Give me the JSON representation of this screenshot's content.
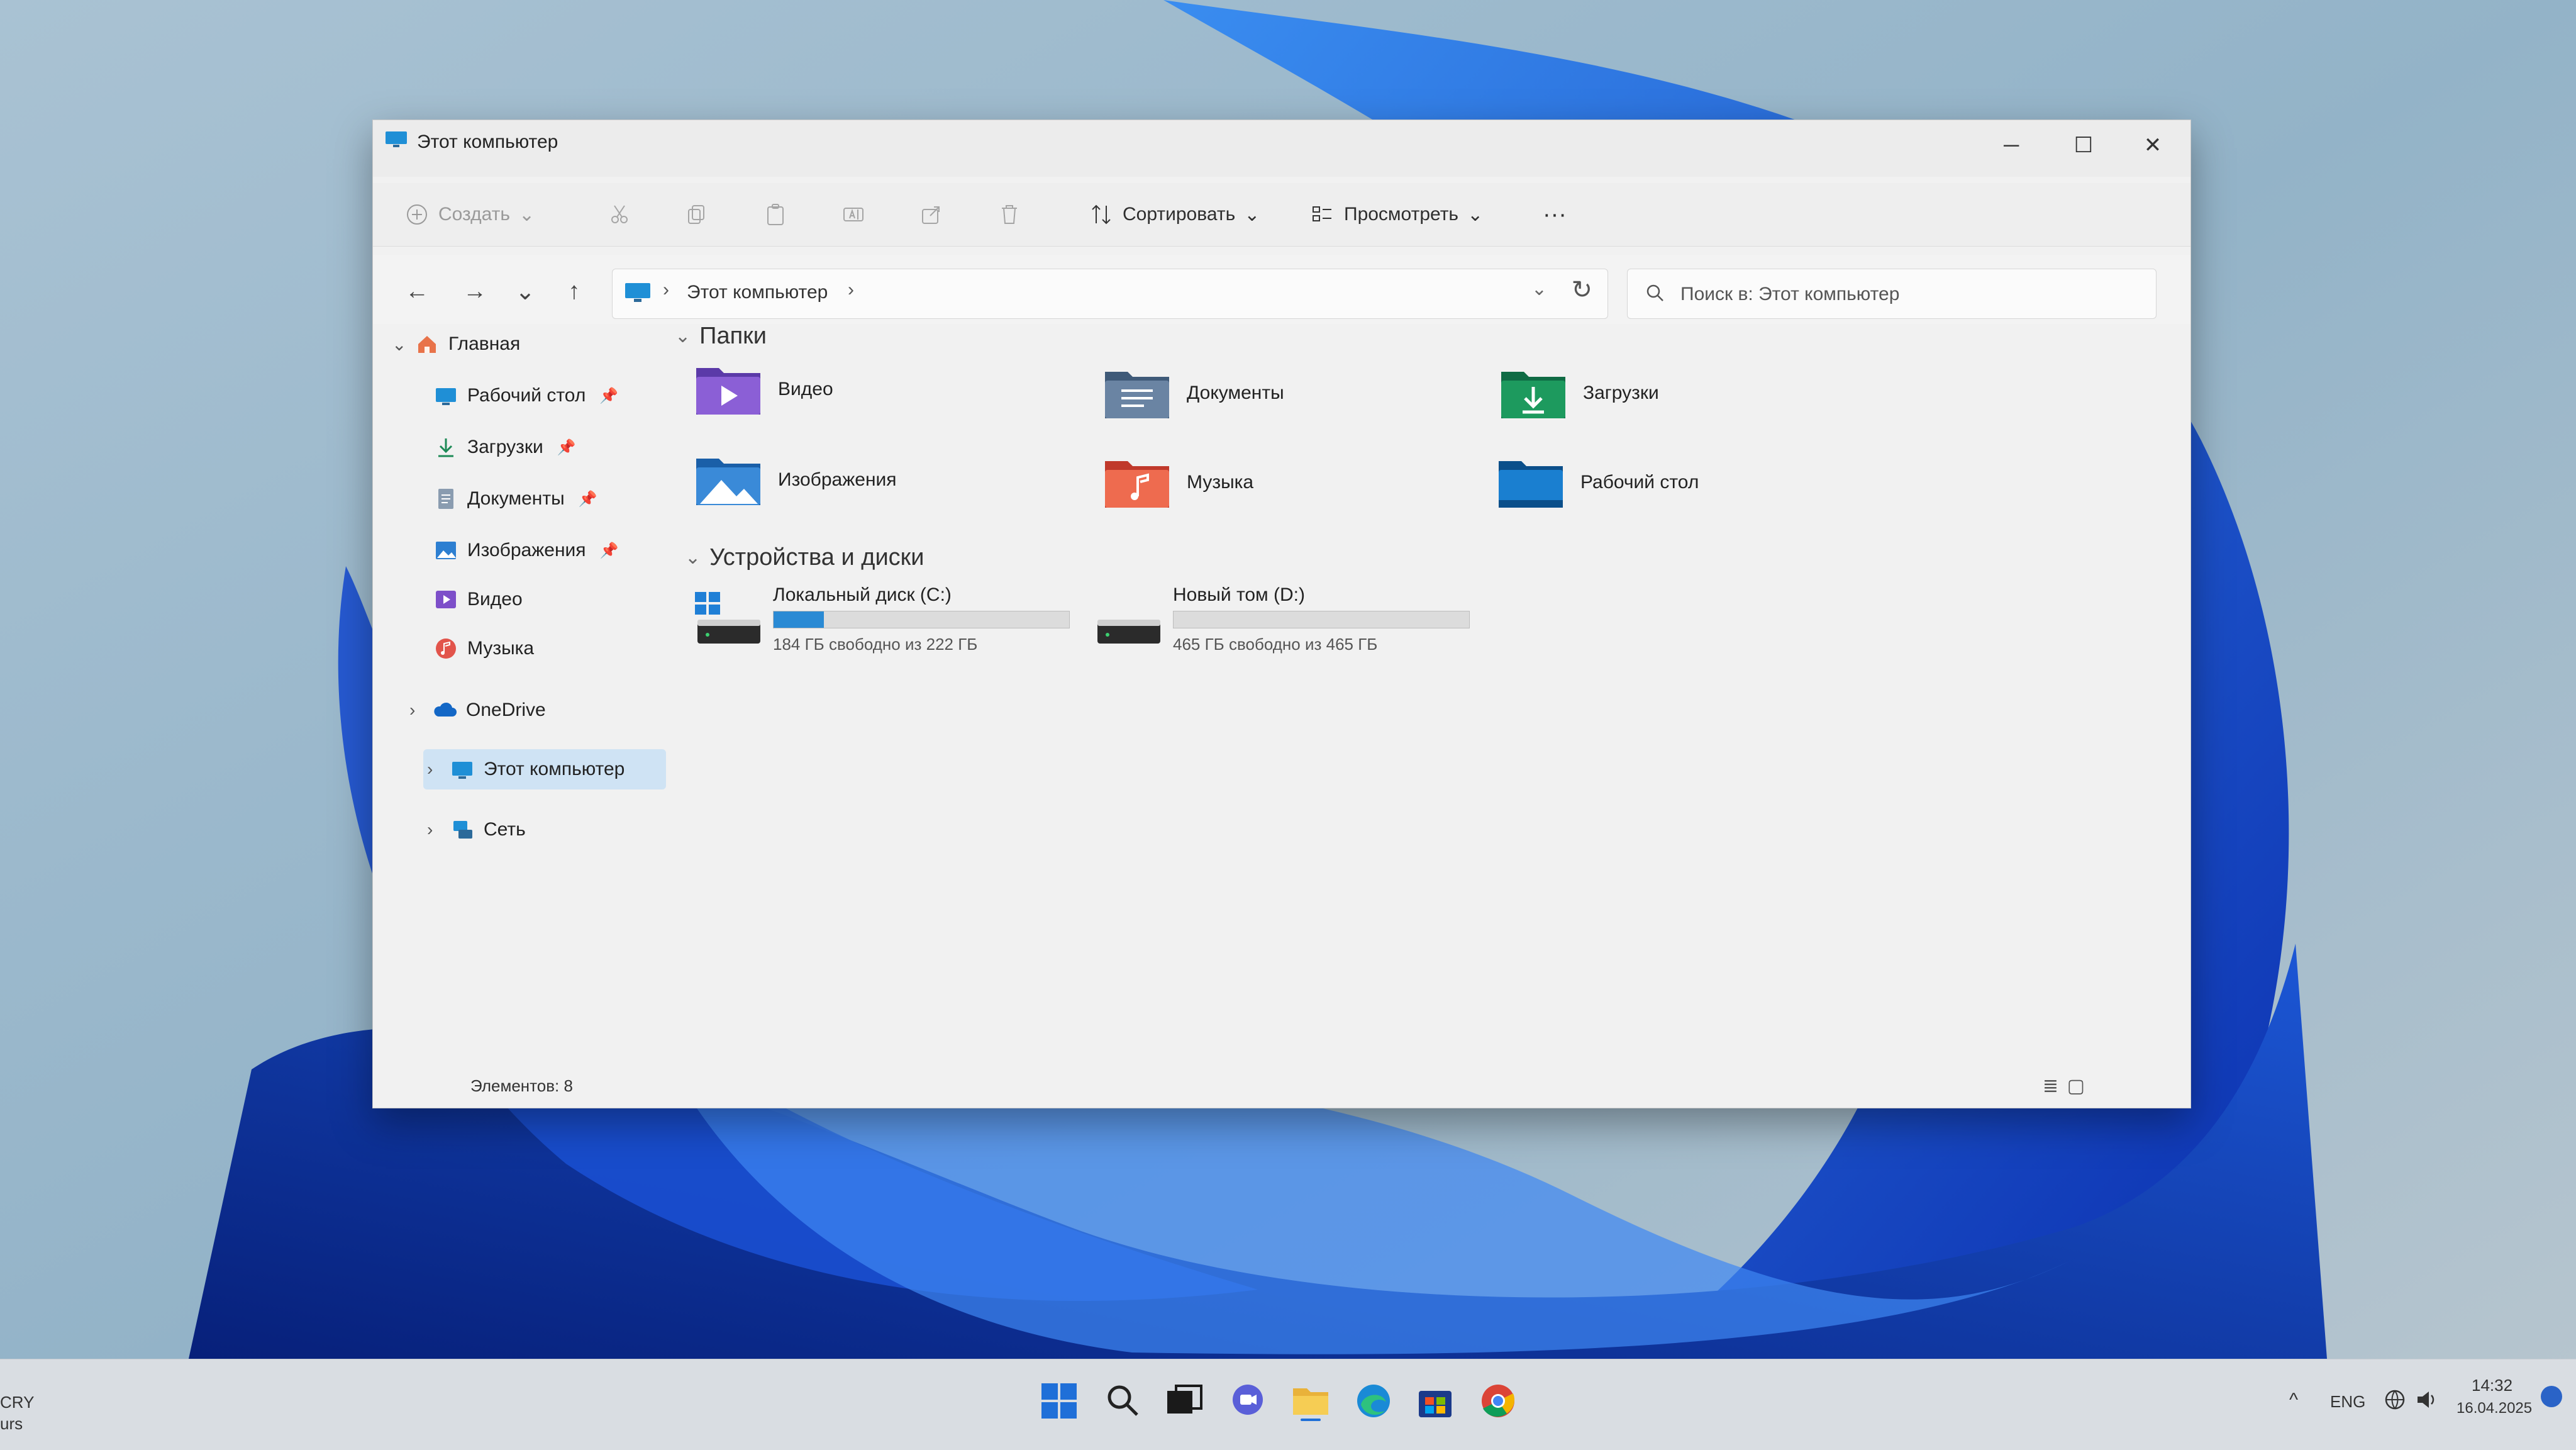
{
  "window": {
    "title": "Этот компьютер",
    "controls": {
      "minimize": "─",
      "maximize": "☐",
      "close": "✕"
    }
  },
  "toolbar": {
    "create": "Создать",
    "sort": "Сортировать",
    "view": "Просмотреть",
    "more": "···"
  },
  "navigation": {
    "back": "←",
    "forward": "→",
    "recent": "⌄",
    "up": "↑",
    "address": "Этот компьютер",
    "separator": "›",
    "refresh": "↻",
    "search_placeholder": "Поиск в: Этот компьютер"
  },
  "sidebar": {
    "items": [
      {
        "label": "Главная",
        "pinned": false
      },
      {
        "label": "Рабочий стол",
        "pinned": true
      },
      {
        "label": "Загрузки",
        "pinned": true
      },
      {
        "label": "Документы",
        "pinned": true
      },
      {
        "label": "Изображения",
        "pinned": true
      },
      {
        "label": "Видео",
        "pinned": false
      },
      {
        "label": "Музыка",
        "pinned": false
      },
      {
        "label": "OneDrive",
        "pinned": false
      },
      {
        "label": "Этот компьютер",
        "pinned": false,
        "selected": true
      },
      {
        "label": "Сеть",
        "pinned": false
      }
    ],
    "pin_glyph": "📌"
  },
  "content": {
    "folders_header": "Папки",
    "folders": [
      {
        "label": "Видео",
        "icon": "video-folder-icon"
      },
      {
        "label": "Документы",
        "icon": "documents-folder-icon"
      },
      {
        "label": "Загрузки",
        "icon": "downloads-folder-icon"
      },
      {
        "label": "Изображения",
        "icon": "pictures-folder-icon"
      },
      {
        "label": "Музыка",
        "icon": "music-folder-icon"
      },
      {
        "label": "Рабочий стол",
        "icon": "desktop-folder-icon"
      }
    ],
    "devices_header": "Устройства и диски",
    "drives": [
      {
        "name": "Локальный диск (C:)",
        "free": "184 ГБ свободно из 222 ГБ",
        "used_fraction": 0.17,
        "bar_color": "#2a8ad4"
      },
      {
        "name": "Новый том (D:)",
        "free": "465 ГБ свободно из 465 ГБ",
        "used_fraction": 0.0,
        "bar_color": "#2a8ad4"
      }
    ]
  },
  "status": {
    "items_count": "Элементов: 8",
    "view_details": "≣",
    "view_tiles": "▢"
  },
  "taskbar": {
    "tray": {
      "lang": "ENG",
      "chevron": "^",
      "time": "14:32",
      "date": "16.04.2025"
    },
    "corner_text": [
      "CRY",
      "urs"
    ]
  },
  "colors": {
    "accent": "#2a8ad4",
    "selection": "#cfe3f4",
    "window_bg": "#f1f1f1"
  }
}
